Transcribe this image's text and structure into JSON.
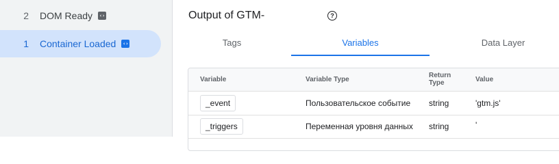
{
  "sidebar": {
    "items": [
      {
        "number": "2",
        "label": "DOM Ready",
        "icon": "code-icon"
      },
      {
        "number": "1",
        "label": "Container Loaded",
        "icon": "code-icon",
        "active": true
      }
    ]
  },
  "header": {
    "title": "Output of GTM-",
    "help_icon": "?"
  },
  "tabs": [
    {
      "label": "Tags"
    },
    {
      "label": "Variables",
      "active": true
    },
    {
      "label": "Data Layer"
    }
  ],
  "table": {
    "columns": [
      "Variable",
      "Variable Type",
      "Return Type",
      "Value"
    ],
    "rows": [
      {
        "variable": "_event",
        "type": "Пользовательское событие",
        "return_type": "string",
        "value": "'gtm.js'"
      },
      {
        "variable": "_triggers",
        "type": "Переменная уровня данных",
        "return_type": "string",
        "value": "'"
      }
    ]
  },
  "colors": {
    "accent": "#1a73e8",
    "sidebar_bg": "#f1f3f4",
    "active_item_bg": "#d2e3fc"
  }
}
